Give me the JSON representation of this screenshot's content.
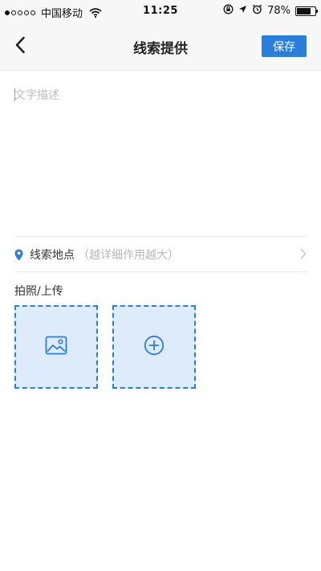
{
  "status_bar": {
    "carrier": "中国移动",
    "time": "11:25",
    "battery": "78%",
    "battery_level": 0.78
  },
  "nav": {
    "title": "线索提供",
    "save_label": "保存"
  },
  "description": {
    "placeholder": "文字描述"
  },
  "location": {
    "label": "线索地点",
    "hint": "（越详细作用越大）"
  },
  "upload": {
    "label": "拍照/上传"
  },
  "icons": {
    "back": "chevron-left-icon",
    "location": "map-pin-icon",
    "chevron": "chevron-right-icon",
    "image": "image-icon",
    "add": "plus-circle-icon"
  },
  "colors": {
    "accent": "#2b7ed9",
    "tile_bg": "#deebfa"
  }
}
